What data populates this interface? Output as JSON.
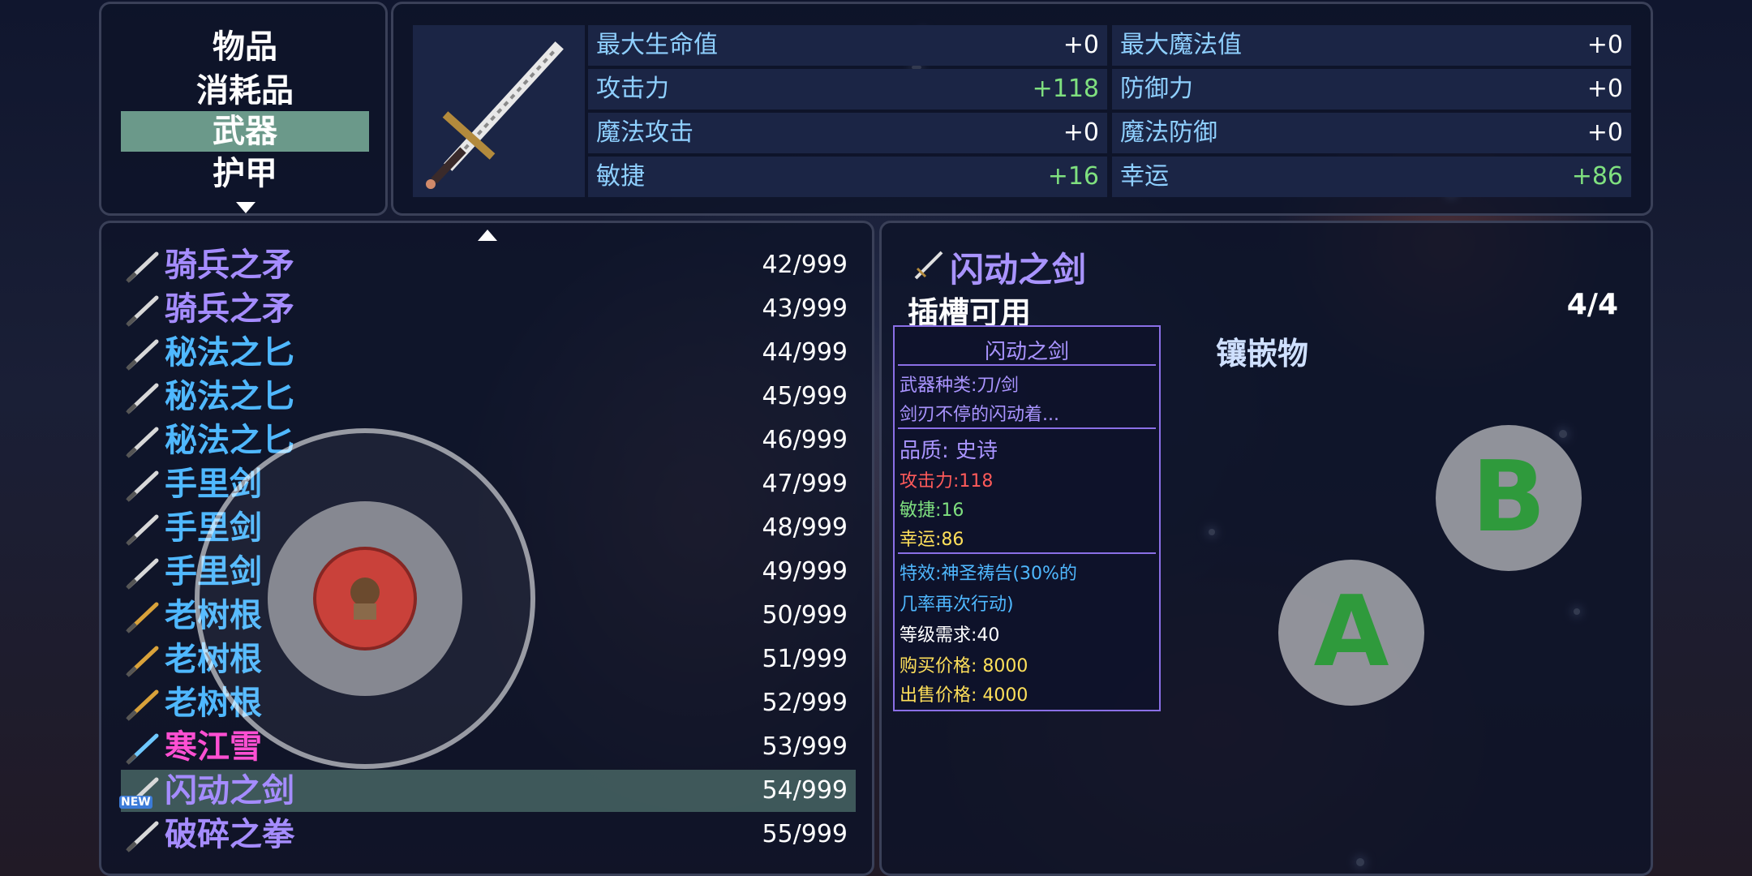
{
  "categories": [
    {
      "label": "物品",
      "selected": false
    },
    {
      "label": "消耗品",
      "selected": false
    },
    {
      "label": "武器",
      "selected": true
    },
    {
      "label": "护甲",
      "selected": false
    }
  ],
  "stats": {
    "left": [
      {
        "label": "最大生命值",
        "value": "+0",
        "positive": false
      },
      {
        "label": "攻击力",
        "value": "+118",
        "positive": true
      },
      {
        "label": "魔法攻击",
        "value": "+0",
        "positive": false
      },
      {
        "label": "敏捷",
        "value": "+16",
        "positive": true
      }
    ],
    "right": [
      {
        "label": "最大魔法值",
        "value": "+0",
        "positive": false
      },
      {
        "label": "防御力",
        "value": "+0",
        "positive": false
      },
      {
        "label": "魔法防御",
        "value": "+0",
        "positive": false
      },
      {
        "label": "幸运",
        "value": "+86",
        "positive": true
      }
    ]
  },
  "items": [
    {
      "name": "骑兵之矛",
      "count": "42/999",
      "color": "#a58cff",
      "icon": "spear-icon"
    },
    {
      "name": "骑兵之矛",
      "count": "43/999",
      "color": "#a58cff",
      "icon": "spear-icon"
    },
    {
      "name": "秘法之匕",
      "count": "44/999",
      "color": "#4fb8ff",
      "icon": "dagger-icon"
    },
    {
      "name": "秘法之匕",
      "count": "45/999",
      "color": "#4fb8ff",
      "icon": "dagger-icon"
    },
    {
      "name": "秘法之匕",
      "count": "46/999",
      "color": "#4fb8ff",
      "icon": "dagger-icon"
    },
    {
      "name": "手里剑",
      "count": "47/999",
      "color": "#4fb8ff",
      "icon": "kunai-icon"
    },
    {
      "name": "手里剑",
      "count": "48/999",
      "color": "#4fb8ff",
      "icon": "kunai-icon"
    },
    {
      "name": "手里剑",
      "count": "49/999",
      "color": "#4fb8ff",
      "icon": "kunai-icon"
    },
    {
      "name": "老树根",
      "count": "50/999",
      "color": "#4fb8ff",
      "icon": "staff-icon"
    },
    {
      "name": "老树根",
      "count": "51/999",
      "color": "#4fb8ff",
      "icon": "staff-icon"
    },
    {
      "name": "老树根",
      "count": "52/999",
      "color": "#4fb8ff",
      "icon": "staff-icon"
    },
    {
      "name": "寒江雪",
      "count": "53/999",
      "color": "#ff4fd2",
      "icon": "ice-sword-icon"
    },
    {
      "name": "闪动之剑",
      "count": "54/999",
      "color": "#a58cff",
      "icon": "sword-icon",
      "selected": true,
      "badge": "NEW"
    },
    {
      "name": "破碎之拳",
      "count": "55/999",
      "color": "#a58cff",
      "icon": "gauntlet-icon"
    }
  ],
  "detail": {
    "title": "闪动之剑",
    "slot_label": "插槽可用",
    "slot_count": "4/4",
    "inlay_label": "镶嵌物",
    "tooltip": {
      "header": "闪动之剑",
      "type": "武器种类:刀/剑",
      "desc": "剑刃不停的闪动着...",
      "quality": "品质: 史诗",
      "attack": "攻击力:118",
      "agility": "敏捷:16",
      "luck": "幸运:86",
      "effect1": "特效:神圣祷告(30%的",
      "effect2": "几率再次行动)",
      "level": "等级需求:40",
      "buy": "购买价格: 8000",
      "sell": "出售价格: 4000"
    }
  },
  "buttons": {
    "a": "A",
    "b": "B"
  }
}
